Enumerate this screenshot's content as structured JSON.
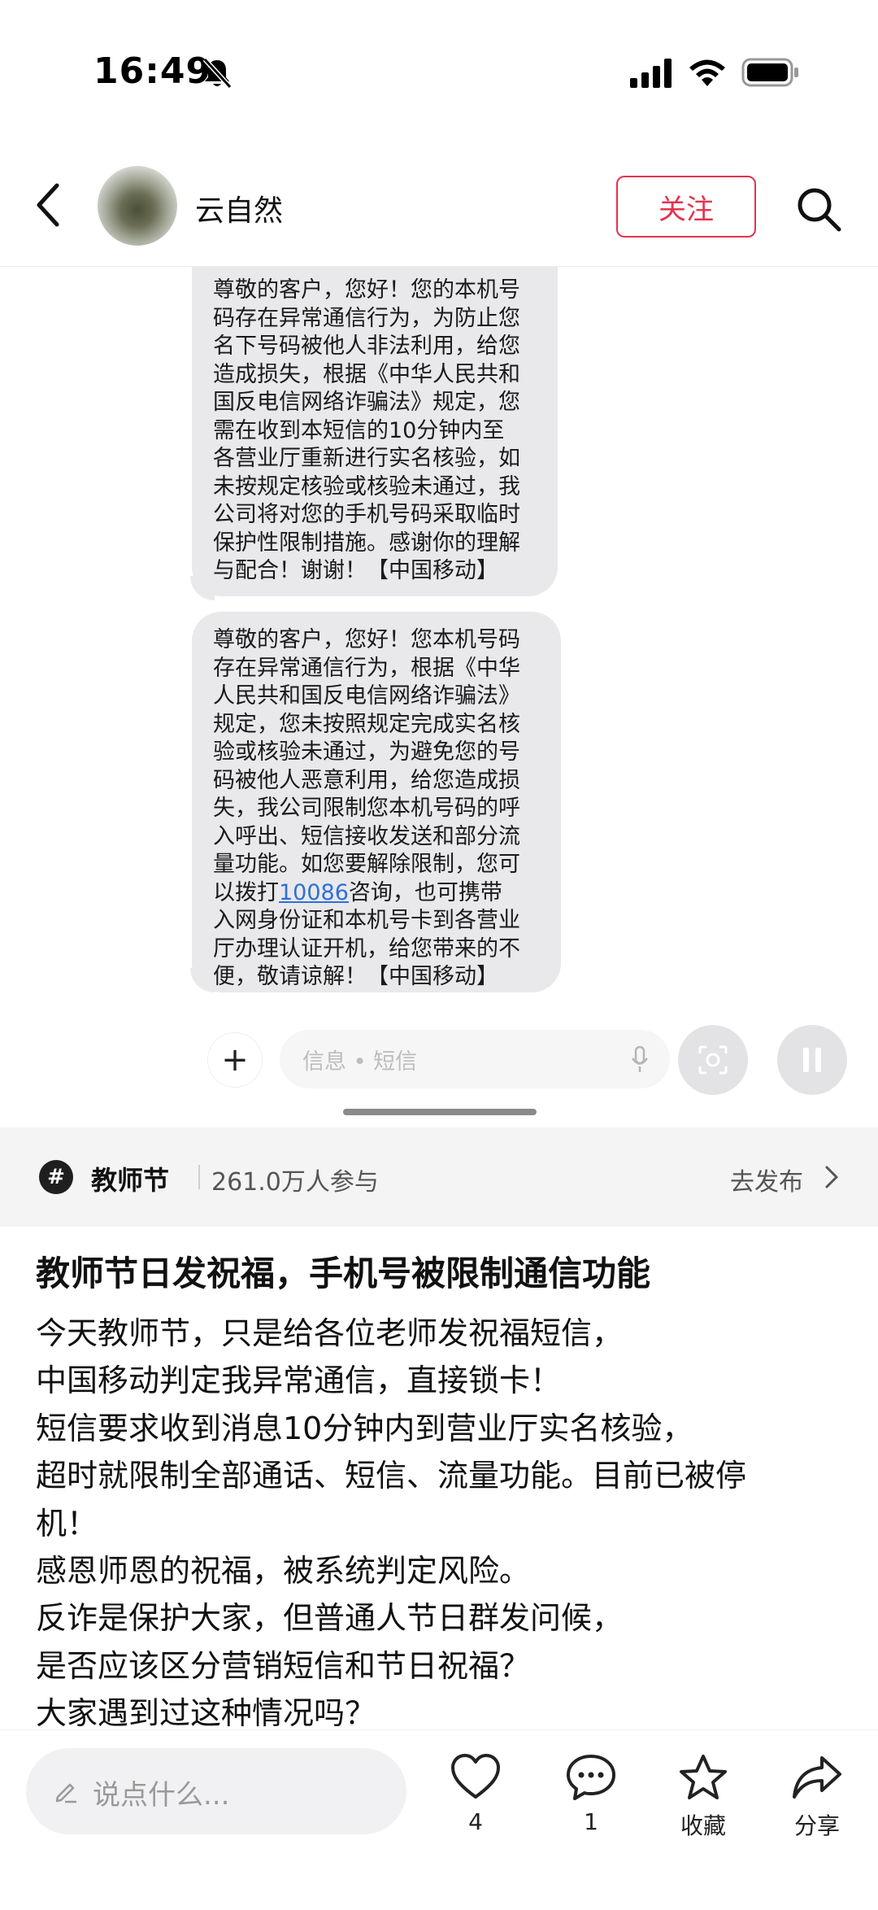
{
  "status_bar": {
    "time": "16:49"
  },
  "header": {
    "username": "云自然",
    "follow_label": "关注"
  },
  "messages": {
    "bubble1": "尊敬的客户，您好！您的本机号\n码存在异常通信行为，为防止您\n名下号码被他人非法利用，给您\n造成损失，根据《中华人民共和\n国反电信网络诈骗法》规定，您\n需在收到本短信的10分钟内至\n各营业厅重新进行实名核验，如\n未按规定核验或核验未通过，我\n公司将对您的手机号码采取临时\n保护性限制措施。感谢你的理解\n与配合！谢谢！【中国移动】",
    "bubble2_part1": "尊敬的客户，您好！您本机号码\n存在异常通信行为，根据《中华\n人民共和国反电信网络诈骗法》\n规定，您未按照规定完成实名核\n验或核验未通过，为避免您的号\n码被他人恶意利用，给您造成损\n失，我公司限制您本机号码的呼\n入呼出、短信接收发送和部分流\n量功能。如您要解除限制，您可\n以拨打",
    "bubble2_link": "10086",
    "bubble2_part2": "咨询，也可携带\n入网身份证和本机号卡到各营业\n厅办理认证开机，给您带来的不\n便，敬请谅解！【中国移动】",
    "input_placeholder": "信息 • 短信"
  },
  "topic": {
    "name": "教师节",
    "participants": "261.0万人参与",
    "action_label": "去发布"
  },
  "post": {
    "title": "教师节日发祝福，手机号被限制通信功能",
    "lines": [
      "今天教师节，只是给各位老师发祝福短信，",
      "中国移动判定我异常通信，直接锁卡！",
      "短信要求收到消息10分钟内到营业厅实名核验，",
      "超时就限制全部通话、短信、流量功能。目前已被停",
      "机！",
      "感恩师恩的祝福，被系统判定风险。",
      "反诈是保护大家，但普通人节日群发问候，",
      "是否应该区分营销短信和节日祝福？",
      "大家遇到过这种情况吗？"
    ]
  },
  "bottom_bar": {
    "comment_placeholder": "说点什么...",
    "like_count": "4",
    "comment_count": "1",
    "favorite_label": "收藏",
    "share_label": "分享"
  },
  "colors": {
    "accent": "#e5334d",
    "link": "#2e6fd8",
    "bubble": "#e9e9ec"
  }
}
